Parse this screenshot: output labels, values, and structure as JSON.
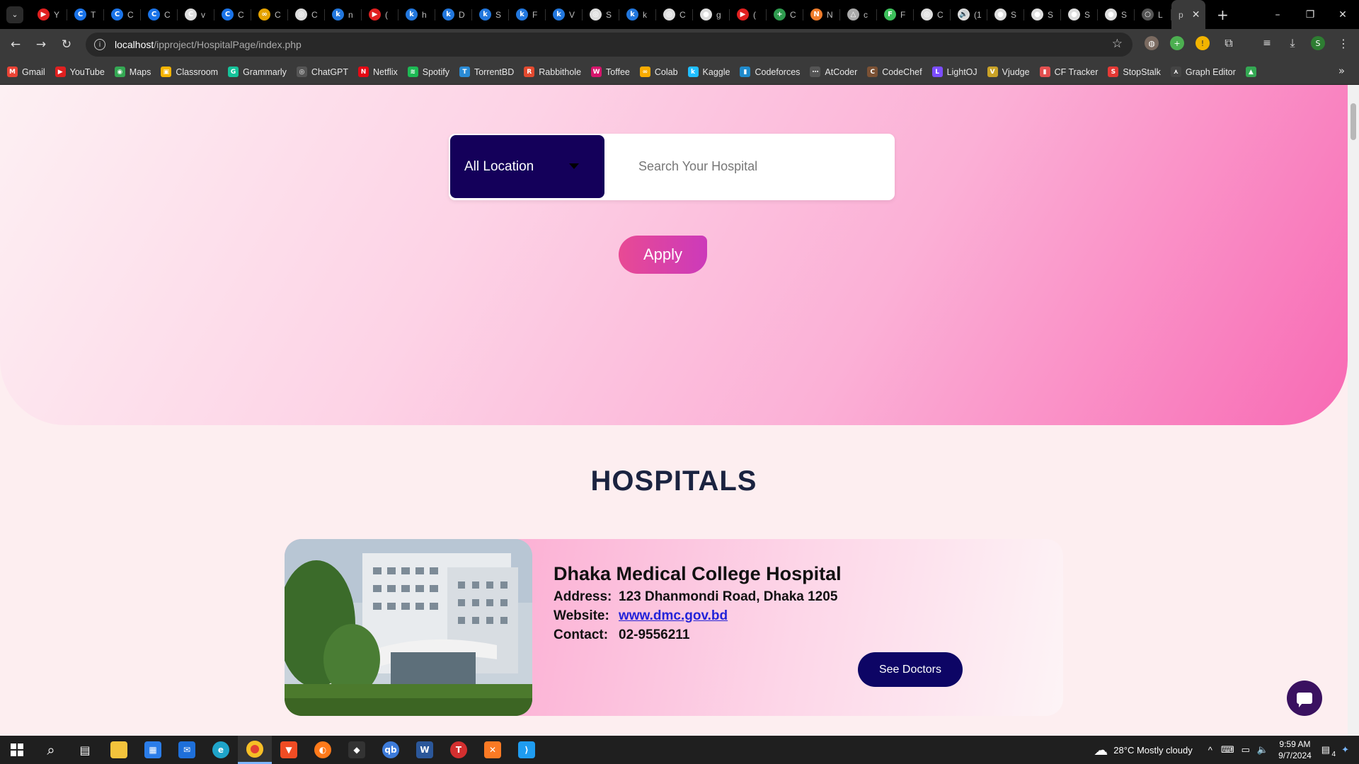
{
  "browser": {
    "tabs": [
      {
        "letter": "Y",
        "color": "#e02020",
        "glyph": "▶"
      },
      {
        "letter": "T",
        "color": "#1a73e8",
        "glyph": "C"
      },
      {
        "letter": "C",
        "color": "#1a73e8",
        "glyph": "C"
      },
      {
        "letter": "C",
        "color": "#1a73e8",
        "glyph": "C"
      },
      {
        "letter": "v",
        "color": "#dddddd",
        "glyph": "C"
      },
      {
        "letter": "C",
        "color": "#1a73e8",
        "glyph": "C"
      },
      {
        "letter": "C",
        "color": "#e6a300",
        "glyph": "∞"
      },
      {
        "letter": "C",
        "color": "#dddddd",
        "glyph": "◎"
      },
      {
        "letter": "n",
        "color": "#2277dd",
        "glyph": "k"
      },
      {
        "letter": "(",
        "color": "#e02020",
        "glyph": "▶"
      },
      {
        "letter": "h",
        "color": "#2277dd",
        "glyph": "k"
      },
      {
        "letter": "D",
        "color": "#2277dd",
        "glyph": "k"
      },
      {
        "letter": "S",
        "color": "#2277dd",
        "glyph": "k"
      },
      {
        "letter": "F",
        "color": "#2277dd",
        "glyph": "k"
      },
      {
        "letter": "V",
        "color": "#2277dd",
        "glyph": "k"
      },
      {
        "letter": "S",
        "color": "#dddddd",
        "glyph": "◎"
      },
      {
        "letter": "k",
        "color": "#2277dd",
        "glyph": "k"
      },
      {
        "letter": "C",
        "color": "#dddddd",
        "glyph": "◎"
      },
      {
        "letter": "g",
        "color": "#dddddd",
        "glyph": "●"
      },
      {
        "letter": "(",
        "color": "#e02020",
        "glyph": "▶"
      },
      {
        "letter": "C",
        "color": "#2e9b4e",
        "glyph": "+"
      },
      {
        "letter": "N",
        "color": "#f07c2a",
        "glyph": "N"
      },
      {
        "letter": "c",
        "color": "#aaaaaa",
        "glyph": "△"
      },
      {
        "letter": "F",
        "color": "#3cbf5a",
        "glyph": "F"
      },
      {
        "letter": "C",
        "color": "#dddddd",
        "glyph": "◎"
      },
      {
        "letter": "(1",
        "color": "#dddddd",
        "glyph": "🔊"
      },
      {
        "letter": "S",
        "color": "#dddddd",
        "glyph": "●"
      },
      {
        "letter": "S",
        "color": "#dddddd",
        "glyph": "●"
      },
      {
        "letter": "S",
        "color": "#dddddd",
        "glyph": "●"
      },
      {
        "letter": "S",
        "color": "#dddddd",
        "glyph": "●"
      },
      {
        "letter": "L",
        "color": "#555555",
        "glyph": "○"
      }
    ],
    "active_tab": {
      "letter": "p",
      "close": "✕"
    },
    "new_tab": "+",
    "window": {
      "minimize": "–",
      "restore": "❐",
      "close": "✕"
    },
    "nav": {
      "back": "←",
      "forward": "→",
      "reload": "↻"
    },
    "url_host": "localhost",
    "url_path": "/ipproject/HospitalPage/index.php",
    "bookmark_star": "☆",
    "profile_initial": "S",
    "bookmarks": [
      {
        "label": "Gmail",
        "color": "#ea4335",
        "glyph": "M"
      },
      {
        "label": "YouTube",
        "color": "#e02020",
        "glyph": "▶"
      },
      {
        "label": "Maps",
        "color": "#34a853",
        "glyph": "◉"
      },
      {
        "label": "Classroom",
        "color": "#f6b400",
        "glyph": "▣"
      },
      {
        "label": "Grammarly",
        "color": "#15c39a",
        "glyph": "G"
      },
      {
        "label": "ChatGPT",
        "color": "#555555",
        "glyph": "◎"
      },
      {
        "label": "Netflix",
        "color": "#e50914",
        "glyph": "N"
      },
      {
        "label": "Spotify",
        "color": "#1db954",
        "glyph": "≋"
      },
      {
        "label": "TorrentBD",
        "color": "#2a8bd6",
        "glyph": "T"
      },
      {
        "label": "Rabbithole",
        "color": "#e34a2f",
        "glyph": "R"
      },
      {
        "label": "Toffee",
        "color": "#d6156c",
        "glyph": "W"
      },
      {
        "label": "Colab",
        "color": "#f9ab00",
        "glyph": "∞"
      },
      {
        "label": "Kaggle",
        "color": "#20beff",
        "glyph": "k"
      },
      {
        "label": "Codeforces",
        "color": "#1f8acb",
        "glyph": "▮"
      },
      {
        "label": "AtCoder",
        "color": "#555555",
        "glyph": "⋯"
      },
      {
        "label": "CodeChef",
        "color": "#7b5134",
        "glyph": "C"
      },
      {
        "label": "LightOJ",
        "color": "#7c4dff",
        "glyph": "L"
      },
      {
        "label": "Vjudge",
        "color": "#c9a227",
        "glyph": "V"
      },
      {
        "label": "CF Tracker",
        "color": "#e35050",
        "glyph": "▮"
      },
      {
        "label": "StopStalk",
        "color": "#e53935",
        "glyph": "S"
      },
      {
        "label": "Graph Editor",
        "color": "#444444",
        "glyph": "⋏"
      },
      {
        "label": "",
        "color": "#34a853",
        "glyph": "▲"
      }
    ],
    "bookmarks_more": "»"
  },
  "page": {
    "location_select": "All Location",
    "search_placeholder": "Search Your Hospital",
    "apply_label": "Apply",
    "section_title": "HOSPITALS",
    "hospital": {
      "name": "Dhaka Medical College Hospital",
      "address_label": "Address:",
      "address": "123 Dhanmondi Road, Dhaka 1205",
      "website_label": "Website:",
      "website": "www.dmc.gov.bd",
      "contact_label": "Contact:",
      "contact": "02-9556211",
      "button": "See Doctors"
    }
  },
  "taskbar": {
    "weather": "28°C  Mostly cloudy",
    "time": "9:59 AM",
    "date": "9/7/2024",
    "notification_count": "4"
  },
  "colors": {
    "hero_navy": "#14005a",
    "apply_pink": "#e84a94",
    "see_doctors_navy": "#0d0565",
    "title_dark": "#1b2340",
    "chat_purple": "#3a1160"
  }
}
